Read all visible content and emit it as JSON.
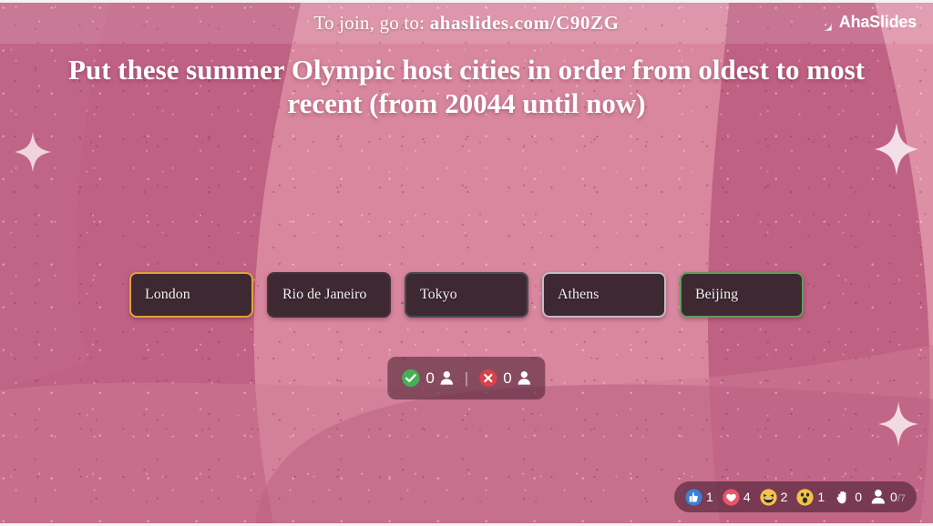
{
  "header": {
    "join_prefix": "To join, go to:",
    "join_url": "ahaslides.com/C90ZG",
    "brand_name": "AhaSlides",
    "brand_icon": "ahaslides-logo-icon"
  },
  "question": {
    "text": "Put these summer Olympic host cities in order from oldest to most recent (from 20044 until now)"
  },
  "cards": [
    {
      "label": "London",
      "border": "gold",
      "border_color": "#e0a33a"
    },
    {
      "label": "Rio de Janeiro",
      "border": "none",
      "border_color": "#4a2f3a"
    },
    {
      "label": "Tokyo",
      "border": "dark",
      "border_color": "#4b4b50"
    },
    {
      "label": "Athens",
      "border": "silver",
      "border_color": "#c2bcc6"
    },
    {
      "label": "Beijing",
      "border": "green",
      "border_color": "#5e9e5a"
    }
  ],
  "counter": {
    "correct_icon": "check-circle-icon",
    "correct_count": "0",
    "correct_person_icon": "person-icon",
    "divider": "|",
    "incorrect_icon": "x-circle-icon",
    "incorrect_count": "0",
    "incorrect_person_icon": "person-icon",
    "correct_color": "#44b056",
    "incorrect_color": "#d8414a"
  },
  "reactions": {
    "items": [
      {
        "icon": "thumbs-up-icon",
        "count": "1",
        "color": "#3d7fd6"
      },
      {
        "icon": "heart-icon",
        "count": "4",
        "color": "#e8566a"
      },
      {
        "icon": "laughing-face-icon",
        "count": "2",
        "color": "#f2c24a"
      },
      {
        "icon": "surprised-face-icon",
        "count": "1",
        "color": "#f2c24a"
      },
      {
        "icon": "raised-hand-icon",
        "count": "0",
        "color": "#ffffff"
      }
    ],
    "participants_icon": "participants-icon",
    "participants_current": "0",
    "participants_divider": "/7"
  },
  "decor": {
    "sparkle_count": 3,
    "background_color": "#c9718f"
  }
}
